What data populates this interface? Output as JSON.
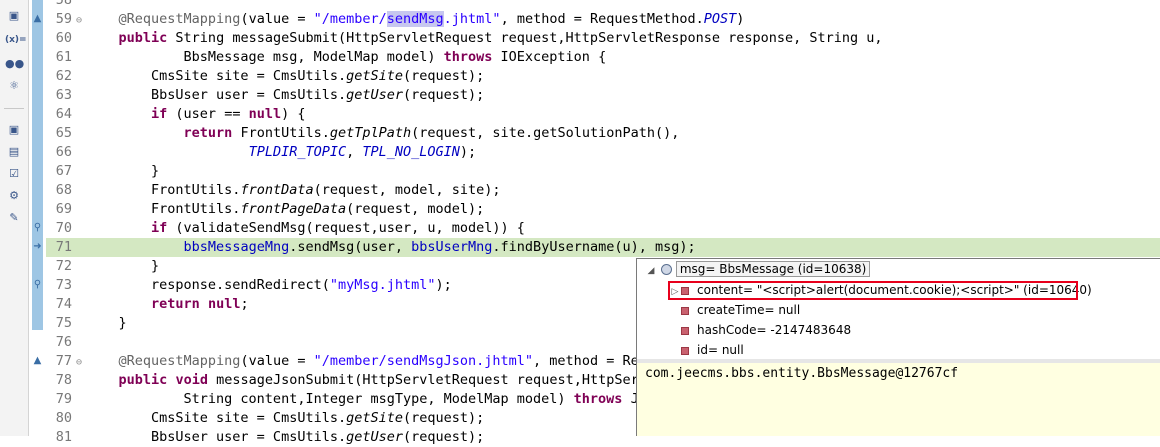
{
  "toolbar": {
    "icons": [
      "variables-view-icon",
      "expressions-icon",
      "breakpoints-icon",
      "registers-icon",
      "outline-icon",
      "display-icon",
      "task-icon",
      "debug-icon",
      "tools-icon"
    ],
    "glyphs": [
      "▣",
      "(x)=",
      "●●",
      "⚛",
      "▣",
      "▤",
      "☑",
      "⚙",
      "✎"
    ]
  },
  "editor": {
    "lines": [
      {
        "n": "58",
        "t": [
          {
            "s": ""
          }
        ]
      },
      {
        "n": "59",
        "fold": "⊖",
        "t": [
          {
            "s": "    "
          },
          {
            "s": "@RequestMapping",
            "c": "ann"
          },
          {
            "s": "(value = "
          },
          {
            "s": "\"/member/",
            "c": "str"
          },
          {
            "s": "sendMsg",
            "c": "str sel"
          },
          {
            "s": ".jhtml\"",
            "c": "str"
          },
          {
            "s": ", method = RequestMethod."
          },
          {
            "s": "POST",
            "c": "cst"
          },
          {
            "s": ")"
          }
        ]
      },
      {
        "n": "60",
        "t": [
          {
            "s": "    "
          },
          {
            "s": "public",
            "c": "kw"
          },
          {
            "s": " String messageSubmit(HttpServletRequest request,HttpServletResponse response, String u,"
          }
        ]
      },
      {
        "n": "61",
        "t": [
          {
            "s": "            BbsMessage msg, ModelMap model) "
          },
          {
            "s": "throws",
            "c": "kw"
          },
          {
            "s": " IOException {"
          }
        ]
      },
      {
        "n": "62",
        "t": [
          {
            "s": "        CmsSite site = CmsUtils."
          },
          {
            "s": "getSite",
            "c": "it"
          },
          {
            "s": "(request);"
          }
        ]
      },
      {
        "n": "63",
        "t": [
          {
            "s": "        BbsUser user = CmsUtils."
          },
          {
            "s": "getUser",
            "c": "it"
          },
          {
            "s": "(request);"
          }
        ]
      },
      {
        "n": "64",
        "t": [
          {
            "s": "        "
          },
          {
            "s": "if",
            "c": "kw"
          },
          {
            "s": " (user == "
          },
          {
            "s": "null",
            "c": "kw"
          },
          {
            "s": ") {"
          }
        ]
      },
      {
        "n": "65",
        "t": [
          {
            "s": "            "
          },
          {
            "s": "return",
            "c": "kw"
          },
          {
            "s": " FrontUtils."
          },
          {
            "s": "getTplPath",
            "c": "it"
          },
          {
            "s": "(request, site.getSolutionPath(),"
          }
        ]
      },
      {
        "n": "66",
        "t": [
          {
            "s": "                    "
          },
          {
            "s": "TPLDIR_TOPIC",
            "c": "cst"
          },
          {
            "s": ", "
          },
          {
            "s": "TPL_NO_LOGIN",
            "c": "cst"
          },
          {
            "s": ");"
          }
        ]
      },
      {
        "n": "67",
        "t": [
          {
            "s": "        }"
          }
        ]
      },
      {
        "n": "68",
        "t": [
          {
            "s": "        FrontUtils."
          },
          {
            "s": "frontData",
            "c": "it"
          },
          {
            "s": "(request, model, site);"
          }
        ]
      },
      {
        "n": "69",
        "t": [
          {
            "s": "        FrontUtils."
          },
          {
            "s": "frontPageData",
            "c": "it"
          },
          {
            "s": "(request, model);"
          }
        ]
      },
      {
        "n": "70",
        "t": [
          {
            "s": "        "
          },
          {
            "s": "if",
            "c": "kw"
          },
          {
            "s": " (validateSendMsg(request,user, u, model)) {"
          }
        ]
      },
      {
        "n": "71",
        "hl": true,
        "t": [
          {
            "s": "            "
          },
          {
            "s": "bbsMessageMng",
            "c": "fld"
          },
          {
            "s": ".sendMsg(user, "
          },
          {
            "s": "bbsUserMng",
            "c": "fld"
          },
          {
            "s": ".findByUsername(u), msg);"
          }
        ]
      },
      {
        "n": "72",
        "t": [
          {
            "s": "        }"
          }
        ]
      },
      {
        "n": "73",
        "t": [
          {
            "s": "        response.sendRedirect("
          },
          {
            "s": "\"myMsg.jhtml\"",
            "c": "str"
          },
          {
            "s": ");"
          }
        ]
      },
      {
        "n": "74",
        "t": [
          {
            "s": "        "
          },
          {
            "s": "return",
            "c": "kw"
          },
          {
            "s": " "
          },
          {
            "s": "null",
            "c": "kw"
          },
          {
            "s": ";"
          }
        ]
      },
      {
        "n": "75",
        "t": [
          {
            "s": "    }"
          }
        ]
      },
      {
        "n": "76",
        "t": [
          {
            "s": ""
          }
        ]
      },
      {
        "n": "77",
        "fold": "⊖",
        "t": [
          {
            "s": "    "
          },
          {
            "s": "@RequestMapping",
            "c": "ann"
          },
          {
            "s": "(value = "
          },
          {
            "s": "\"/member/sendMsgJson.jhtml\"",
            "c": "str"
          },
          {
            "s": ", method = Requ"
          }
        ]
      },
      {
        "n": "78",
        "t": [
          {
            "s": "    "
          },
          {
            "s": "public",
            "c": "kw"
          },
          {
            "s": " "
          },
          {
            "s": "void",
            "c": "kw"
          },
          {
            "s": " messageJsonSubmit(HttpServletRequest request,HttpServl"
          }
        ]
      },
      {
        "n": "79",
        "t": [
          {
            "s": "            String content,Integer msgType, ModelMap model) "
          },
          {
            "s": "throws",
            "c": "kw"
          },
          {
            "s": " JS"
          }
        ]
      },
      {
        "n": "80",
        "t": [
          {
            "s": "        CmsSite site = CmsUtils."
          },
          {
            "s": "getSite",
            "c": "it"
          },
          {
            "s": "(request);"
          }
        ]
      },
      {
        "n": "81",
        "t": [
          {
            "s": "        BbsUser user = CmsUtils."
          },
          {
            "s": "getUser",
            "c": "it"
          },
          {
            "s": "(request);"
          }
        ]
      }
    ]
  },
  "debug_popup": {
    "root": "msg= BbsMessage  (id=10638)",
    "fields": [
      {
        "label": "content= \"<script>alert(document.cookie);<script>\" (id=10640)",
        "expandable": true,
        "selected": true
      },
      {
        "label": "createTime= null"
      },
      {
        "label": "hashCode= -2147483648"
      },
      {
        "label": "id= null"
      }
    ],
    "detail": "com.jeecms.bbs.entity.BbsMessage@12767cf",
    "selection_color": "#e8001c"
  }
}
